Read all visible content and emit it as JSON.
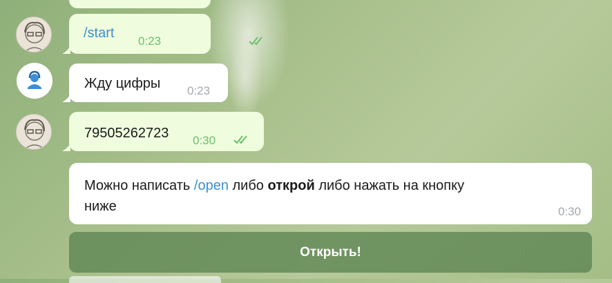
{
  "messages": [
    {
      "id": "m1",
      "text_cmd": "/start",
      "time": "0:23"
    },
    {
      "id": "m2",
      "text": "Жду цифры",
      "time": "0:23"
    },
    {
      "id": "m3",
      "text": "79505262723",
      "time": "0:30"
    },
    {
      "id": "m4",
      "parts": {
        "p1": "Можно написать ",
        "cmd": "/open",
        "p2": " либо ",
        "bold": "открой",
        "p3": " либо нажать на кнопку",
        "line2": "ниже"
      },
      "time": "0:30"
    }
  ],
  "keyboard": {
    "button_label": "Открыть!"
  },
  "colors": {
    "outgoing_bubble": "#effdde",
    "incoming_bubble": "#ffffff",
    "command_link": "#3a8fd0",
    "read_ticks": "#6cbf6a"
  }
}
